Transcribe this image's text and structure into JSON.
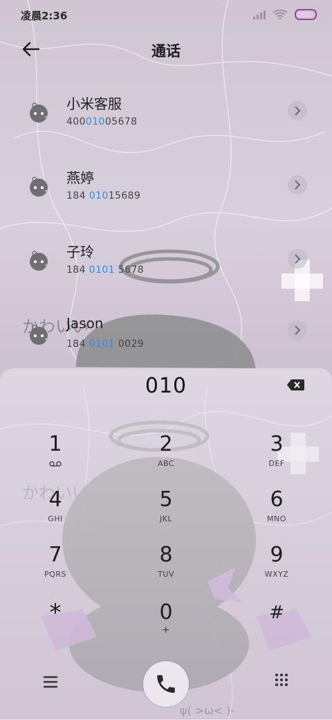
{
  "status_bar": {
    "time": "凌晨2:36"
  },
  "header": {
    "title": "通话"
  },
  "contacts": [
    {
      "name": "小米客服",
      "number_prefix": "400",
      "number_match": "010",
      "number_suffix": "05678"
    },
    {
      "name": "燕婷",
      "number_prefix": "184 ",
      "number_match": "010",
      "number_suffix": "15689"
    },
    {
      "name": "子玲",
      "number_prefix": "184 ",
      "number_match": "0101",
      "number_suffix": " 5678"
    },
    {
      "name": "Jason",
      "number_prefix": "184 ",
      "number_match": "0101",
      "number_suffix": " 0029"
    }
  ],
  "dialer": {
    "entered_number": "010",
    "keys": [
      {
        "digit": "1",
        "letters": ""
      },
      {
        "digit": "2",
        "letters": "ABC"
      },
      {
        "digit": "3",
        "letters": "DEF"
      },
      {
        "digit": "4",
        "letters": "GHI"
      },
      {
        "digit": "5",
        "letters": "JKL"
      },
      {
        "digit": "6",
        "letters": "MNO"
      },
      {
        "digit": "7",
        "letters": "PQRS"
      },
      {
        "digit": "8",
        "letters": "TUV"
      },
      {
        "digit": "9",
        "letters": "WXYZ"
      },
      {
        "digit": "*",
        "letters": ""
      },
      {
        "digit": "0",
        "letters": "+"
      },
      {
        "digit": "#",
        "letters": ""
      }
    ]
  },
  "decor": {
    "kawaii_text": "かわいい",
    "face_text": "ψ( >ω< )-"
  },
  "colors": {
    "highlight": "#2b8ee8",
    "battery": "#8e4c8e",
    "accent_bow": "#c9a6d8"
  }
}
